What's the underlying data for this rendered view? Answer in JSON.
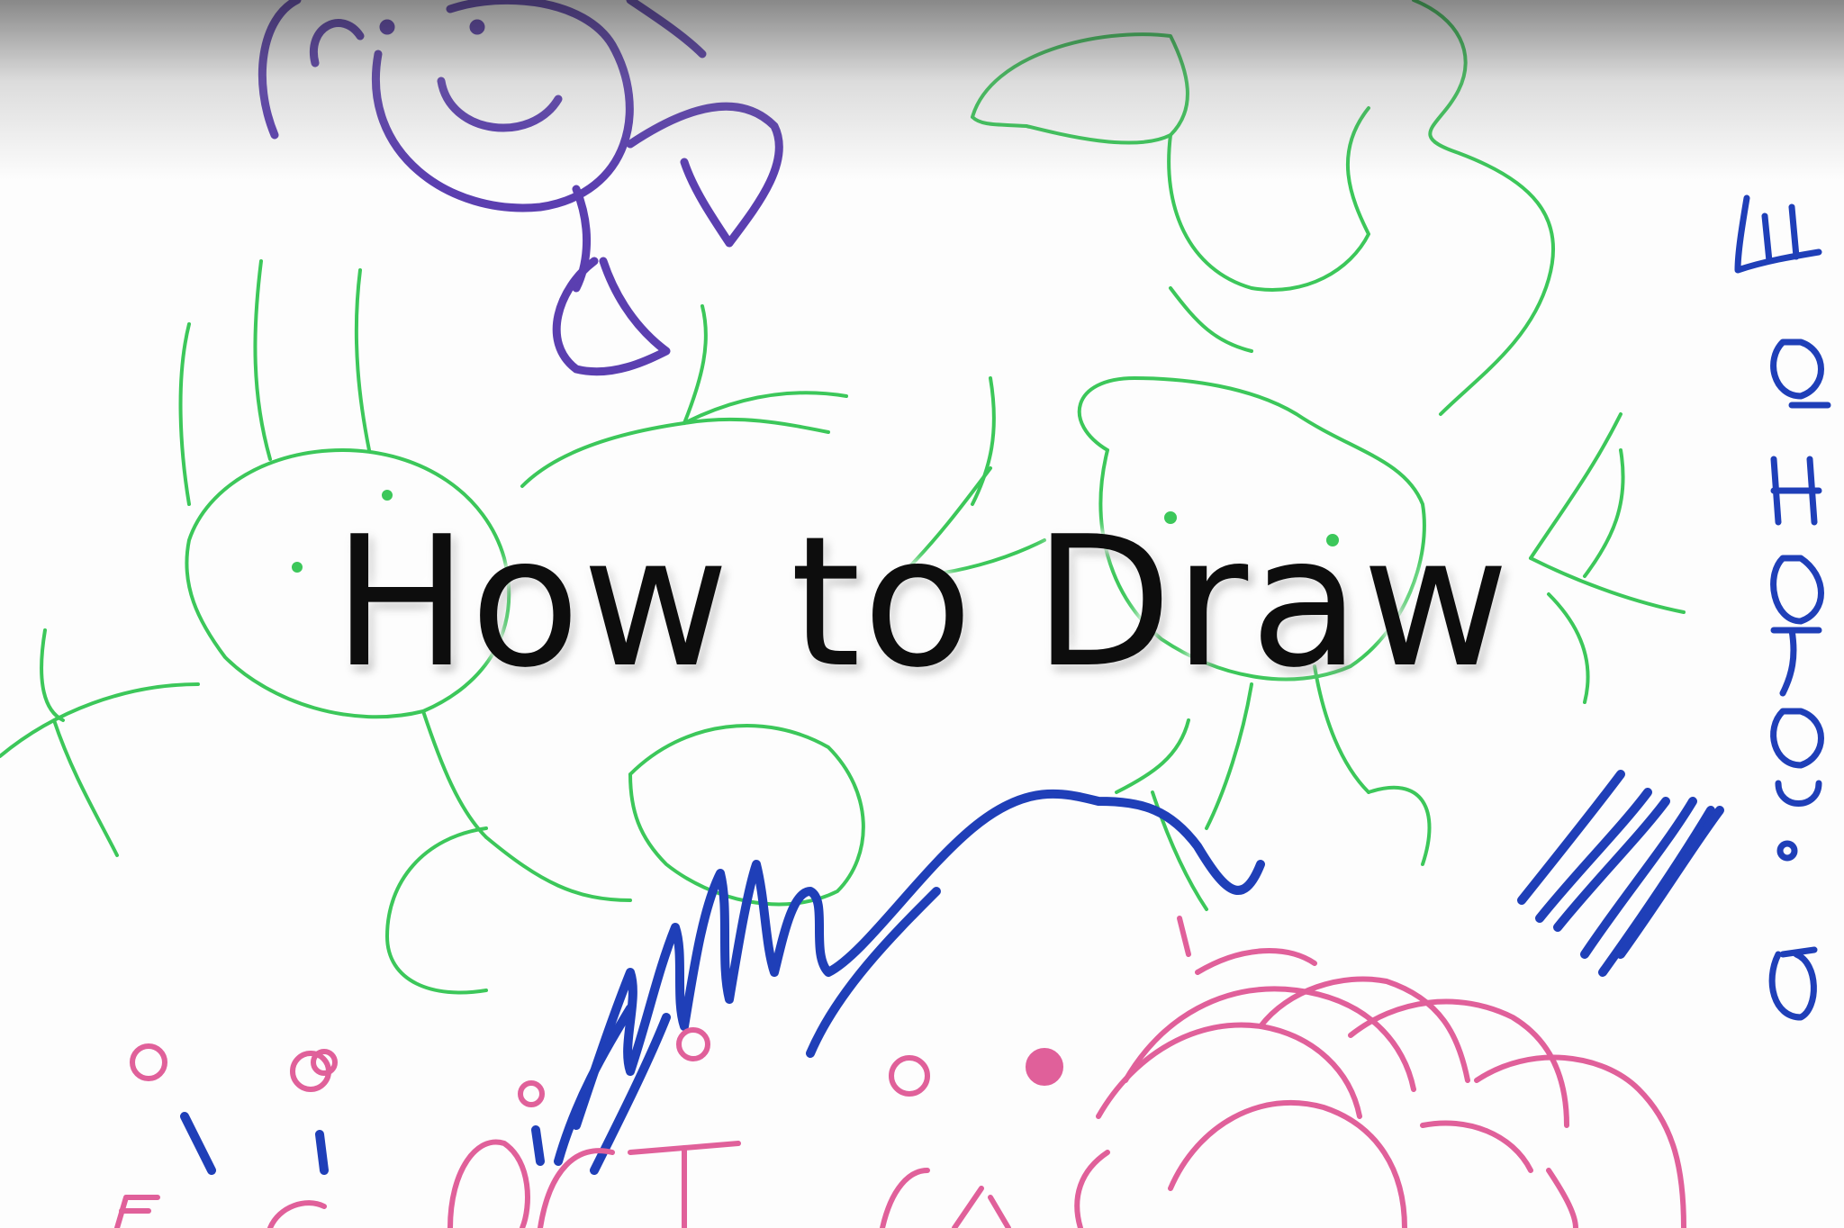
{
  "title": "How to Draw",
  "colors": {
    "purple_marker": "#5b3fb0",
    "green_marker": "#3cc75a",
    "blue_marker": "#1f3fb8",
    "pink_marker": "#e0609a",
    "title_text": "#0d0d0d"
  },
  "drawings": [
    {
      "name": "purple-stick-figure",
      "color": "purple"
    },
    {
      "name": "green-stick-figures",
      "color": "green"
    },
    {
      "name": "blue-scribble",
      "color": "blue"
    },
    {
      "name": "pink-flowers",
      "color": "pink"
    },
    {
      "name": "blue-vertical-letters",
      "color": "blue"
    }
  ]
}
